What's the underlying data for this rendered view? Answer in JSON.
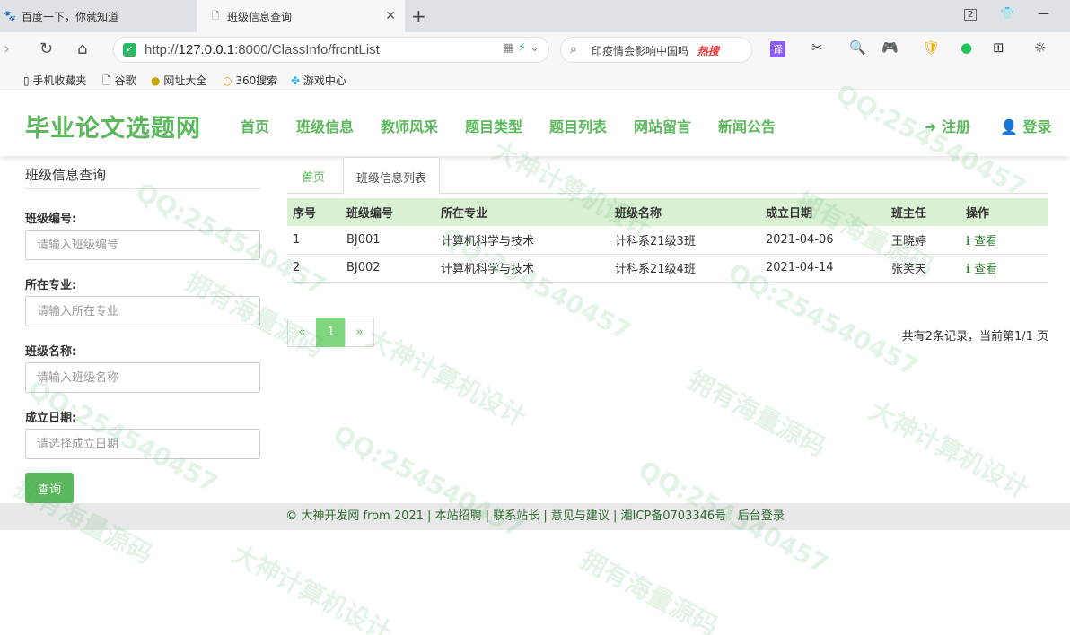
{
  "browser": {
    "tabs": [
      {
        "label": "百度一下，你就知道",
        "active": false
      },
      {
        "label": "班级信息查询",
        "active": true
      }
    ],
    "url_prefix": "http://",
    "url_host": "127.0.0.1",
    "url_rest": ":8000/ClassInfo/frontList",
    "search_text": "印疫情会影响中国吗",
    "search_badge": "热搜",
    "tab_count": "2",
    "translate_label": "译"
  },
  "bookmarks": [
    "手机收藏夹",
    "谷歌",
    "网址大全",
    "360搜索",
    "游戏中心"
  ],
  "site": {
    "logo": "毕业论文选题网",
    "nav": [
      "首页",
      "班级信息",
      "教师风采",
      "题目类型",
      "题目列表",
      "网站留言",
      "新闻公告"
    ],
    "register": "注册",
    "login": "登录"
  },
  "sidebar": {
    "title": "班级信息查询",
    "fields": [
      {
        "label": "班级编号:",
        "placeholder": "请输入班级编号"
      },
      {
        "label": "所在专业:",
        "placeholder": "请输入所在专业"
      },
      {
        "label": "班级名称:",
        "placeholder": "请输入班级名称"
      },
      {
        "label": "成立日期:",
        "placeholder": "请选择成立日期"
      }
    ],
    "query_button": "查询"
  },
  "content": {
    "tabs": [
      "首页",
      "班级信息列表"
    ],
    "columns": [
      "序号",
      "班级编号",
      "所在专业",
      "班级名称",
      "成立日期",
      "班主任",
      "操作"
    ],
    "rows": [
      {
        "idx": "1",
        "code": "BJ001",
        "major": "计算机科学与技术",
        "name": "计科系21级3班",
        "date": "2021-04-06",
        "teacher": "王晓婷",
        "action": "查看"
      },
      {
        "idx": "2",
        "code": "BJ002",
        "major": "计算机科学与技术",
        "name": "计科系21级4班",
        "date": "2021-04-14",
        "teacher": "张笑天",
        "action": "查看"
      }
    ],
    "pager": {
      "prev": "«",
      "current": "1",
      "next": "»"
    },
    "page_info": "共有2条记录，当前第1/1 页"
  },
  "footer": "© 大神开发网 from 2021 | 本站招聘 | 联系站长 | 意见与建议 | 湘ICP备0703346号 | 后台登录",
  "watermarks": [
    "QQ:254540457",
    "拥有海量源码",
    "大神计算机设计"
  ]
}
